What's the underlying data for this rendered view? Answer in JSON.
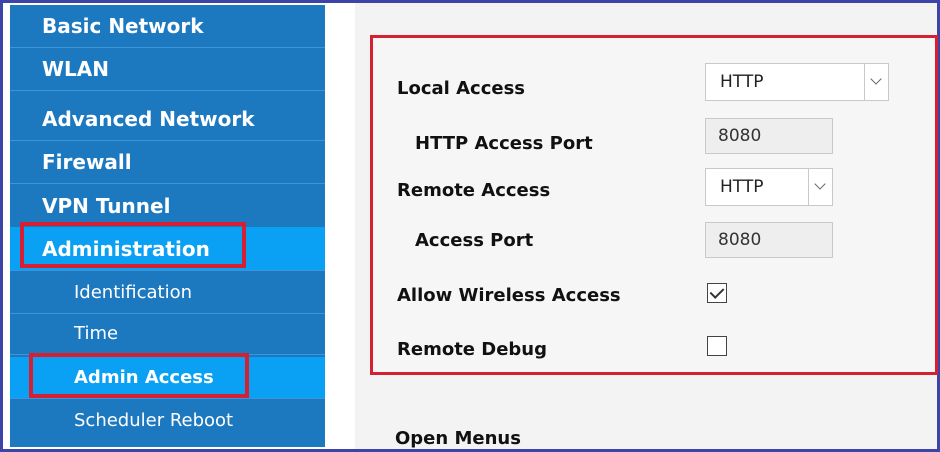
{
  "sidebar": {
    "items": [
      {
        "label": "Basic Network"
      },
      {
        "label": "WLAN"
      },
      {
        "label": "Advanced Network"
      },
      {
        "label": "Firewall"
      },
      {
        "label": "VPN Tunnel"
      },
      {
        "label": "Administration"
      }
    ],
    "subitems": [
      {
        "label": "Identification"
      },
      {
        "label": "Time"
      },
      {
        "label": "Admin Access"
      },
      {
        "label": "Scheduler Reboot"
      }
    ]
  },
  "form": {
    "local_access_label": "Local Access",
    "local_access_value": "HTTP",
    "http_port_label": "HTTP Access Port",
    "http_port_value": "8080",
    "remote_access_label": "Remote Access",
    "remote_access_value": "HTTP",
    "access_port_label": "Access Port",
    "access_port_value": "8080",
    "allow_wireless_label": "Allow Wireless Access",
    "allow_wireless_checked": true,
    "remote_debug_label": "Remote Debug",
    "remote_debug_checked": false
  },
  "section": {
    "open_menus_label": "Open Menus"
  },
  "colors": {
    "sidebar_bg": "#1c79c0",
    "active_bg": "#0aa0f3",
    "highlight_red": "#d51f33",
    "frame_blue": "#3c44a8"
  }
}
